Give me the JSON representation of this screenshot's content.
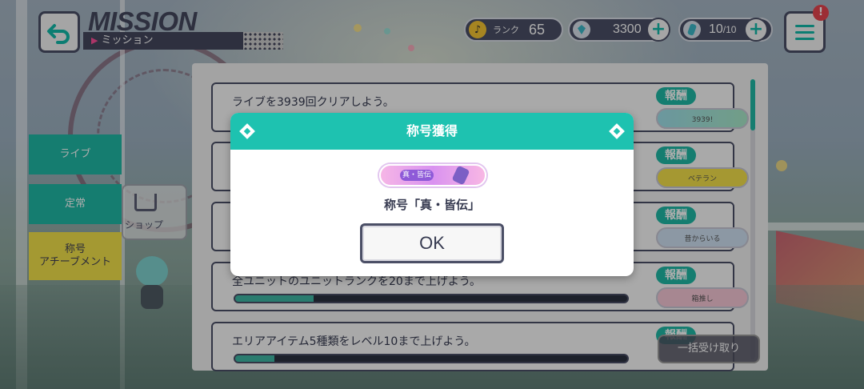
{
  "header": {
    "title": "MISSION",
    "subtitle": "ミッション",
    "back_icon": "back-arrow-icon",
    "menu_icon": "hamburger-menu-icon",
    "notification_badge": "!"
  },
  "resources": {
    "rank_label": "ランク",
    "rank_value": "65",
    "gems": "3300",
    "energy": "10",
    "energy_max": "/10"
  },
  "sidebar": {
    "items": [
      {
        "label": "ライブ"
      },
      {
        "label": "定常"
      },
      {
        "label": "称号\nアチーブメント"
      }
    ],
    "shop_label": "ショップ"
  },
  "missions": [
    {
      "text": "ライブを3939回クリアしよう。",
      "reward_label": "報酬",
      "reward_badge": "3939!",
      "progress": null
    },
    {
      "text": "",
      "reward_label": "報酬",
      "reward_badge": "ベテラン",
      "progress": null
    },
    {
      "text": "",
      "reward_label": "報酬",
      "reward_badge": "昔からいる",
      "progress": null
    },
    {
      "text": "全ユニットのユニットランクを20まで上げよう。",
      "reward_label": "報酬",
      "reward_badge": "箱推し",
      "progress": 0.2
    },
    {
      "text": "エリアアイテム5種類をレベル10まで上げよう。",
      "reward_label": "報酬",
      "reward_badge": "",
      "progress": 0.1
    }
  ],
  "collect_all_label": "一括受け取り",
  "modal": {
    "title": "称号獲得",
    "badge_text": "真・皆伝",
    "message": "称号「真・皆伝」",
    "ok_label": "OK"
  },
  "colors": {
    "accent": "#1ec2b0",
    "dark": "#4b4f66",
    "tab_active": "#f2e24a"
  }
}
